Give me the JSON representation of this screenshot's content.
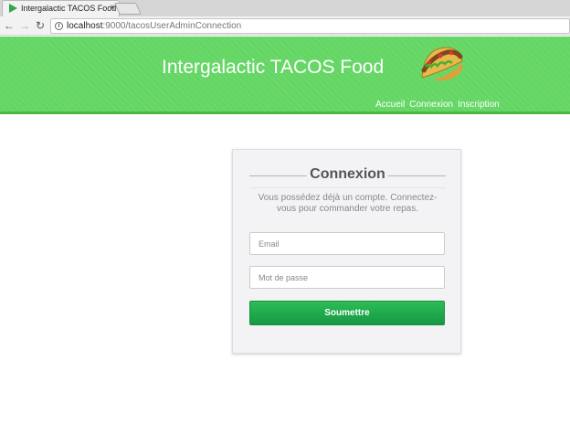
{
  "browser": {
    "tab_title": "Intergalactic TACOS Food",
    "tab_close": "×",
    "url_host": "localhost",
    "url_rest": ":9000/tacosUserAdminConnection"
  },
  "site": {
    "title": "Intergalactic TACOS Food",
    "nav": [
      "Accueil",
      "Connexion",
      "Inscription"
    ]
  },
  "login": {
    "heading": "Connexion",
    "description": "Vous possédez déjà un compte. Connectez-vous pour commander votre repas.",
    "email_placeholder": "Email",
    "password_placeholder": "Mot de passe",
    "submit_label": "Soumettre"
  },
  "colors": {
    "header_green": "#63d663",
    "button_green": "#1fa84b"
  }
}
